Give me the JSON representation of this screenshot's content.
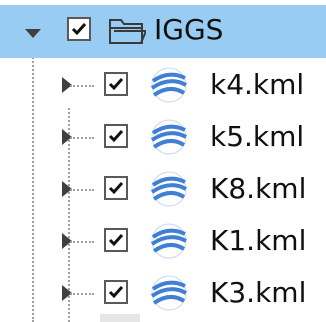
{
  "tree": {
    "root": {
      "label": "IGGS",
      "checked": true,
      "expanded": true,
      "icon": "folder-icon"
    },
    "children": [
      {
        "label": "k4.kml",
        "checked": true,
        "icon": "google-earth-icon"
      },
      {
        "label": "k5.kml",
        "checked": true,
        "icon": "google-earth-icon"
      },
      {
        "label": "K8.kml",
        "checked": true,
        "icon": "google-earth-icon"
      },
      {
        "label": "K1.kml",
        "checked": true,
        "icon": "google-earth-icon"
      },
      {
        "label": "K3.kml",
        "checked": true,
        "icon": "google-earth-icon"
      }
    ]
  },
  "colors": {
    "selection": "#99ccf3",
    "globe": "#3f7fd6",
    "check_border": "#595959"
  }
}
